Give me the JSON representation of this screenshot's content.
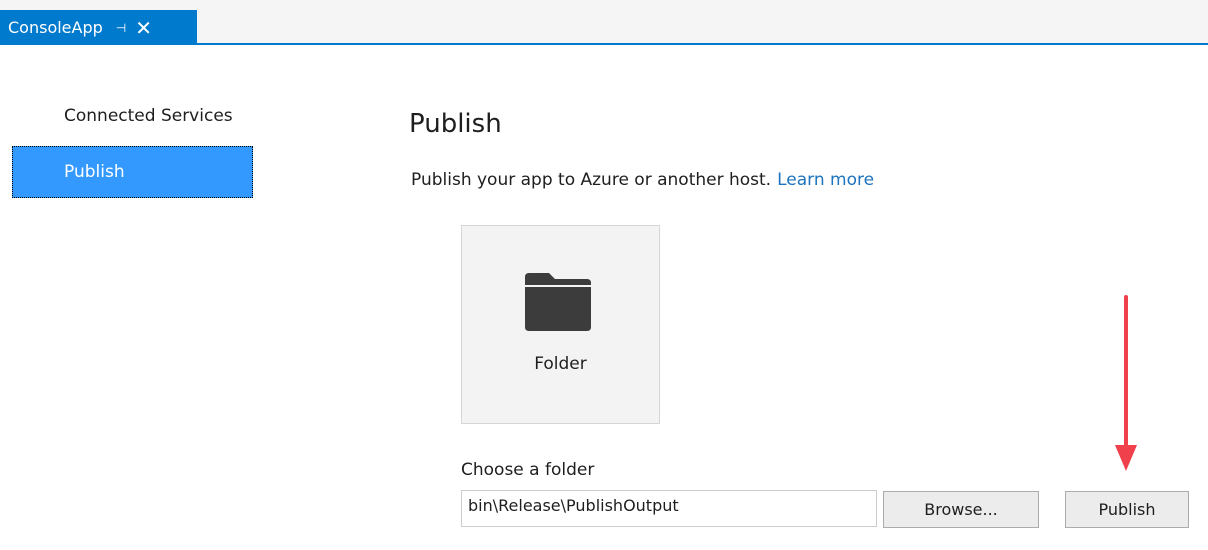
{
  "tab": {
    "title": "ConsoleApp",
    "pin_icon": "⊣",
    "close_icon": "✕",
    "accent_color": "#007acc"
  },
  "sidebar": {
    "items": [
      {
        "label": "Connected Services",
        "selected": false
      },
      {
        "label": "Publish",
        "selected": true
      }
    ],
    "selected_color": "#3399ff"
  },
  "main": {
    "title": "Publish",
    "description": "Publish your app to Azure or another host.",
    "learn_more": "Learn more",
    "target": {
      "label": "Folder",
      "icon": "folder-icon"
    },
    "choose_folder_label": "Choose a folder",
    "folder_path": "bin\\Release\\PublishOutput",
    "browse_label": "Browse...",
    "publish_label": "Publish"
  },
  "annotation": {
    "arrow_color": "#f0404b",
    "points_to": "publish-button"
  }
}
